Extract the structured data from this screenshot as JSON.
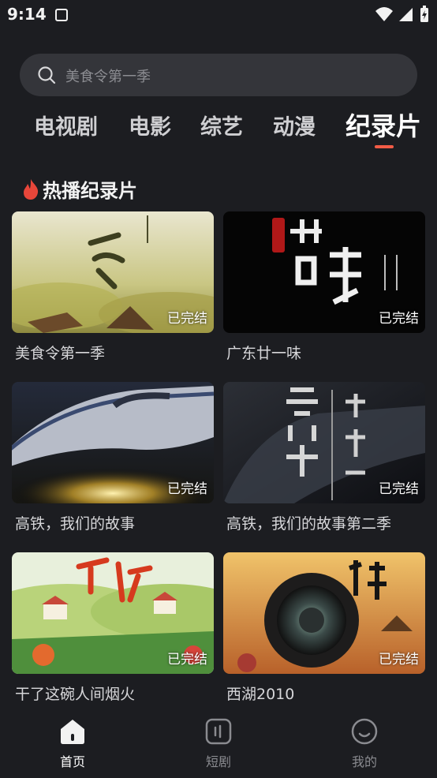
{
  "status_bar": {
    "time": "9:14"
  },
  "search": {
    "placeholder": "美食令第一季"
  },
  "tabs": [
    {
      "label": "电视剧"
    },
    {
      "label": "电影"
    },
    {
      "label": "综艺"
    },
    {
      "label": "动漫"
    },
    {
      "label": "纪录片",
      "active": true
    }
  ],
  "section": {
    "title": "热播纪录片"
  },
  "cards": [
    {
      "title": "美食令第一季",
      "badge": "已完结"
    },
    {
      "title": "广东廿一味",
      "badge": "已完结"
    },
    {
      "title": "高铁，我们的故事",
      "badge": "已完结"
    },
    {
      "title": "高铁，我们的故事第二季",
      "badge": "已完结"
    },
    {
      "title": "干了这碗人间烟火",
      "badge": "已完结"
    },
    {
      "title": "西湖2010",
      "badge": "已完结"
    }
  ],
  "bottom_nav": [
    {
      "label": "首页",
      "icon": "home-icon",
      "active": true
    },
    {
      "label": "短剧",
      "icon": "short-drama-icon"
    },
    {
      "label": "我的",
      "icon": "profile-icon"
    }
  ],
  "colors": {
    "background": "#1c1d21",
    "accent": "#f25c46",
    "search_bg": "#34353a"
  }
}
